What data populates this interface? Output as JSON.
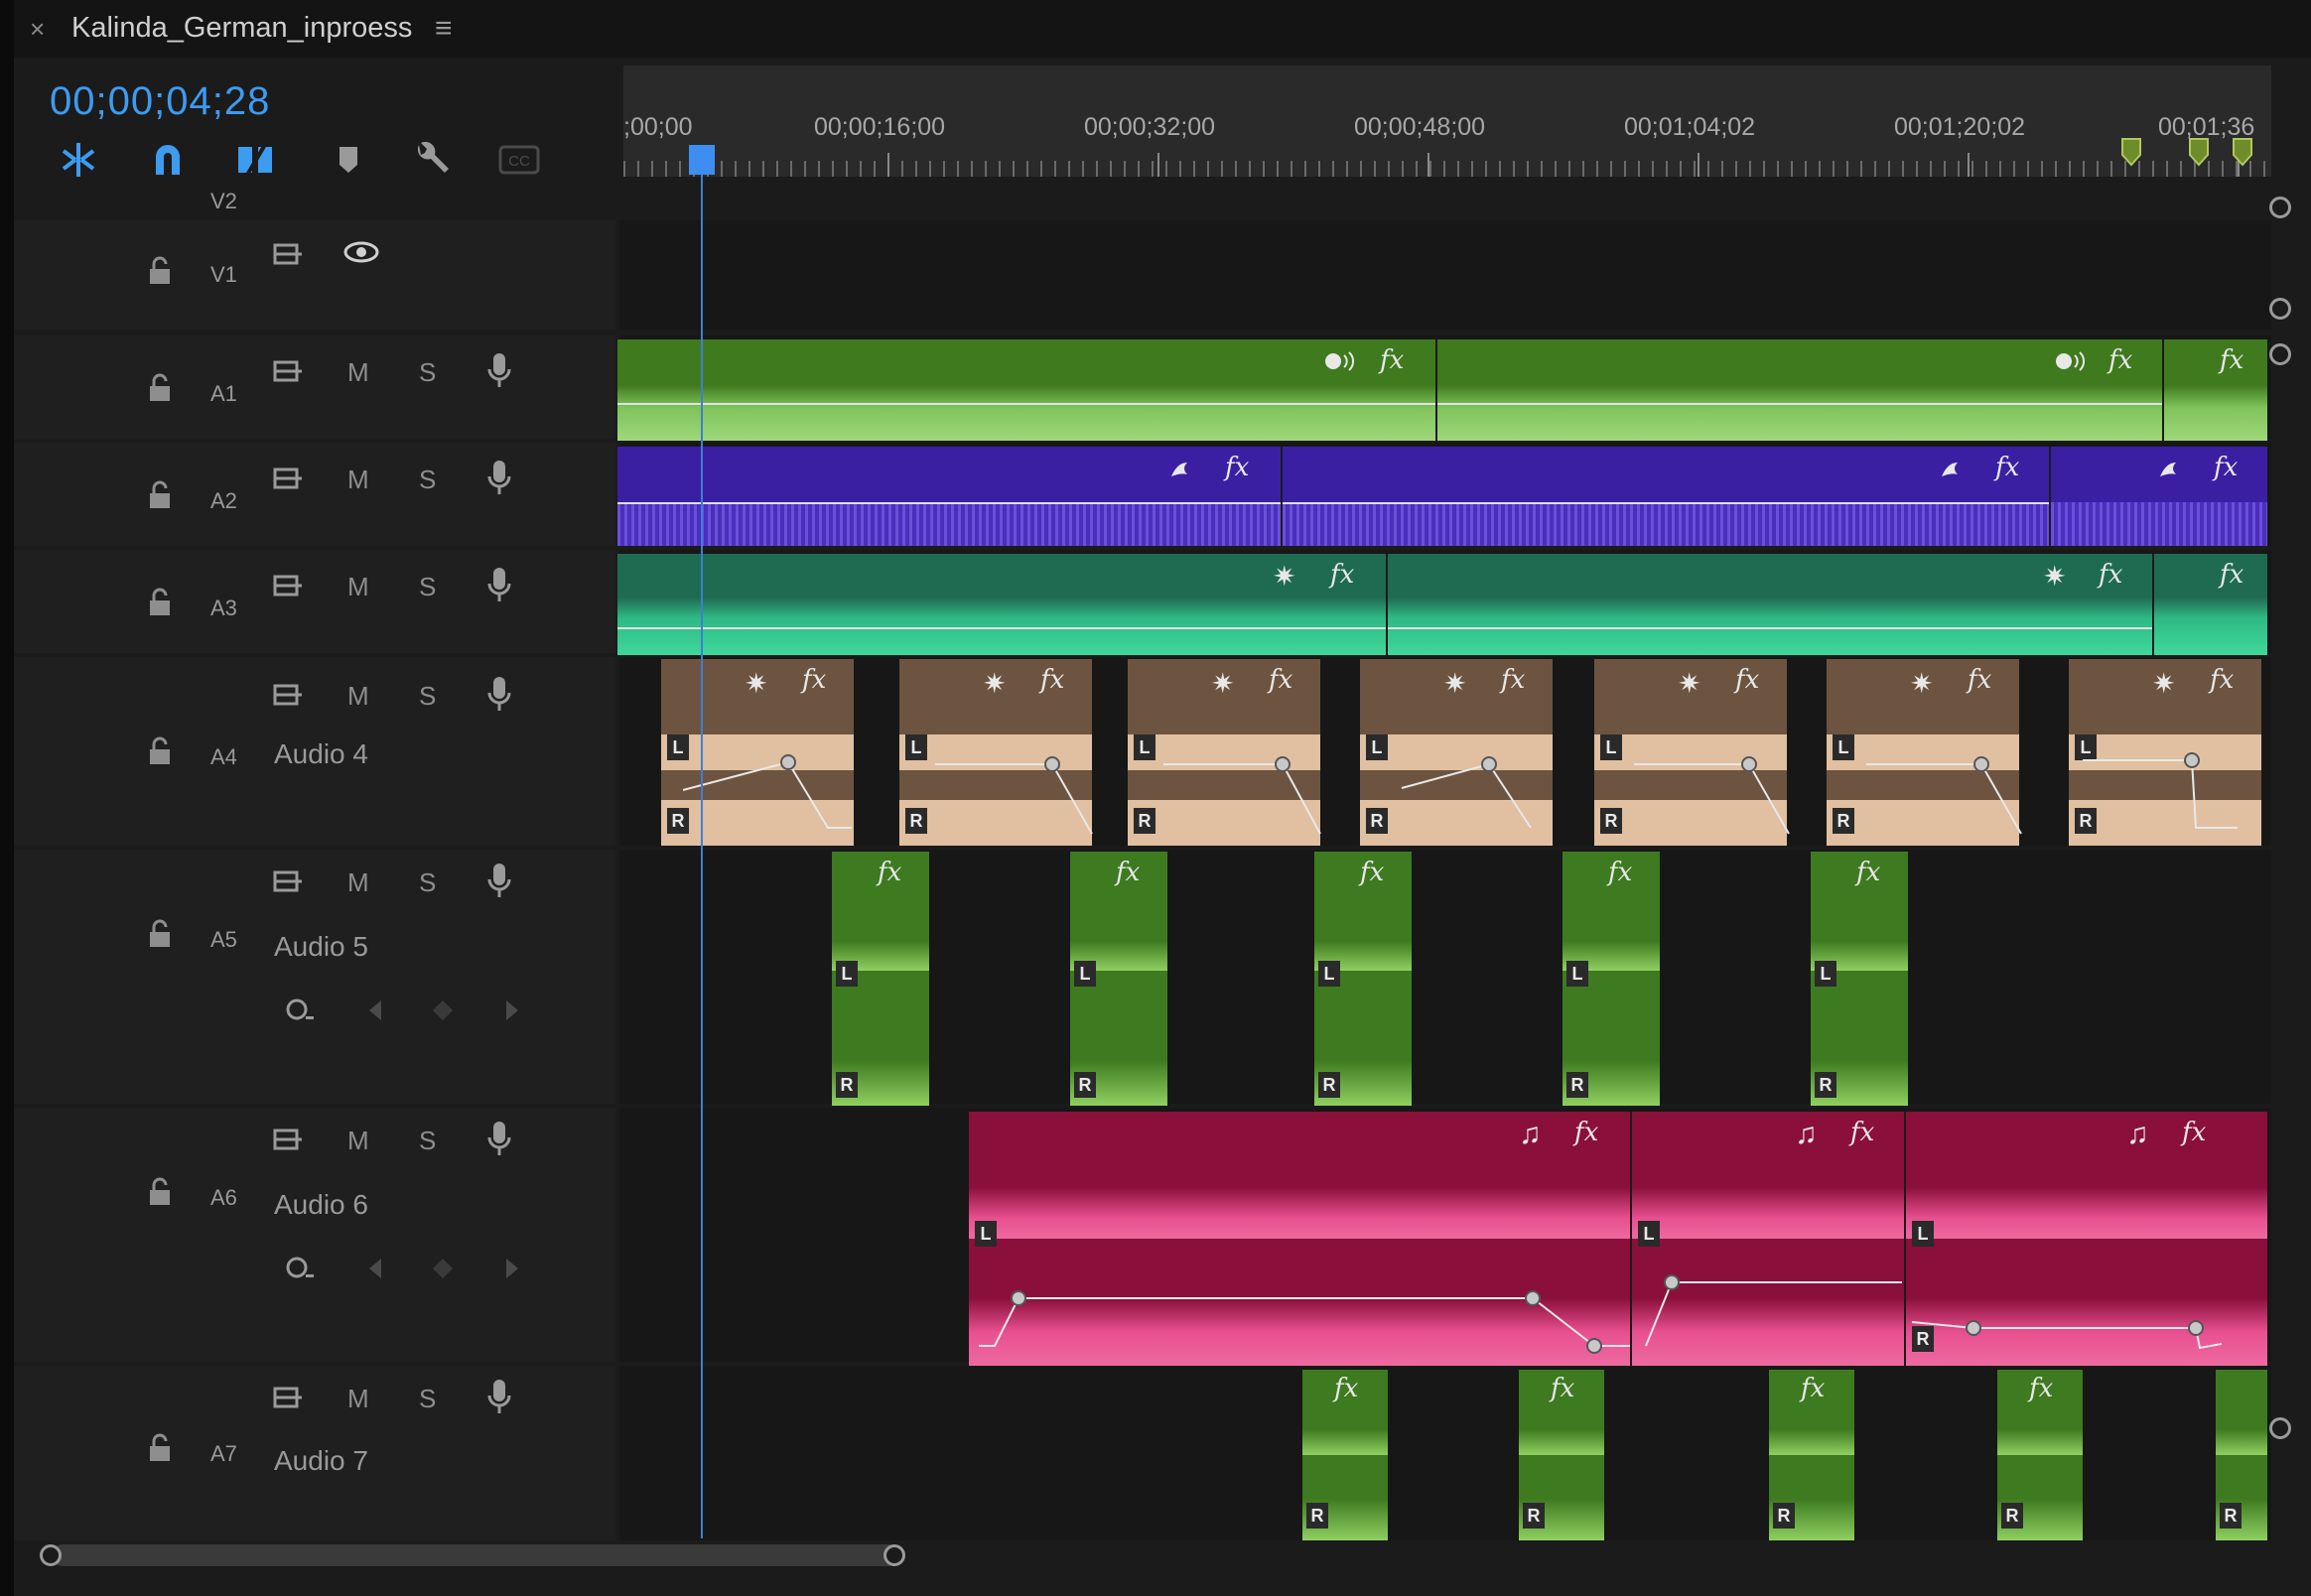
{
  "tab": {
    "close": "×",
    "title": "Kalinda_German_inproess",
    "menu": "≡"
  },
  "timecode": "00;00;04;28",
  "ruler": {
    "labels": [
      ";00;00",
      "00;00;16;00",
      "00;00;32;00",
      "00;00;48;00",
      "00;01;04;02",
      "00;01;20;02",
      "00;01;36"
    ]
  },
  "tools": [
    "insert-tool-icon",
    "snap-icon",
    "linked-selection-icon",
    "add-marker-icon",
    "settings-wrench-icon",
    "captions-icon"
  ],
  "colors": {
    "accent": "#3d9bf0",
    "a1": "#3f7a1e",
    "a2": "#3b1fa3",
    "a3": "#1f6b52",
    "a4": "#6d5440",
    "a5": "#3d7a20",
    "a6": "#8a0f3a",
    "a7": "#3d7a20"
  },
  "tracks": {
    "v2": {
      "label": "V2"
    },
    "v1": {
      "label": "V1"
    },
    "a1": {
      "label": "A1",
      "m": "M",
      "s": "S"
    },
    "a2": {
      "label": "A2",
      "m": "M",
      "s": "S"
    },
    "a3": {
      "label": "A3",
      "m": "M",
      "s": "S"
    },
    "a4": {
      "label": "A4",
      "name": "Audio 4",
      "m": "M",
      "s": "S"
    },
    "a5": {
      "label": "A5",
      "name": "Audio 5",
      "m": "M",
      "s": "S"
    },
    "a6": {
      "label": "A6",
      "name": "Audio 6",
      "m": "M",
      "s": "S"
    },
    "a7": {
      "label": "A7",
      "name": "Audio 7",
      "m": "M",
      "s": "S"
    }
  },
  "clip_labels": {
    "fx": "fx",
    "L": "L",
    "R": "R"
  }
}
